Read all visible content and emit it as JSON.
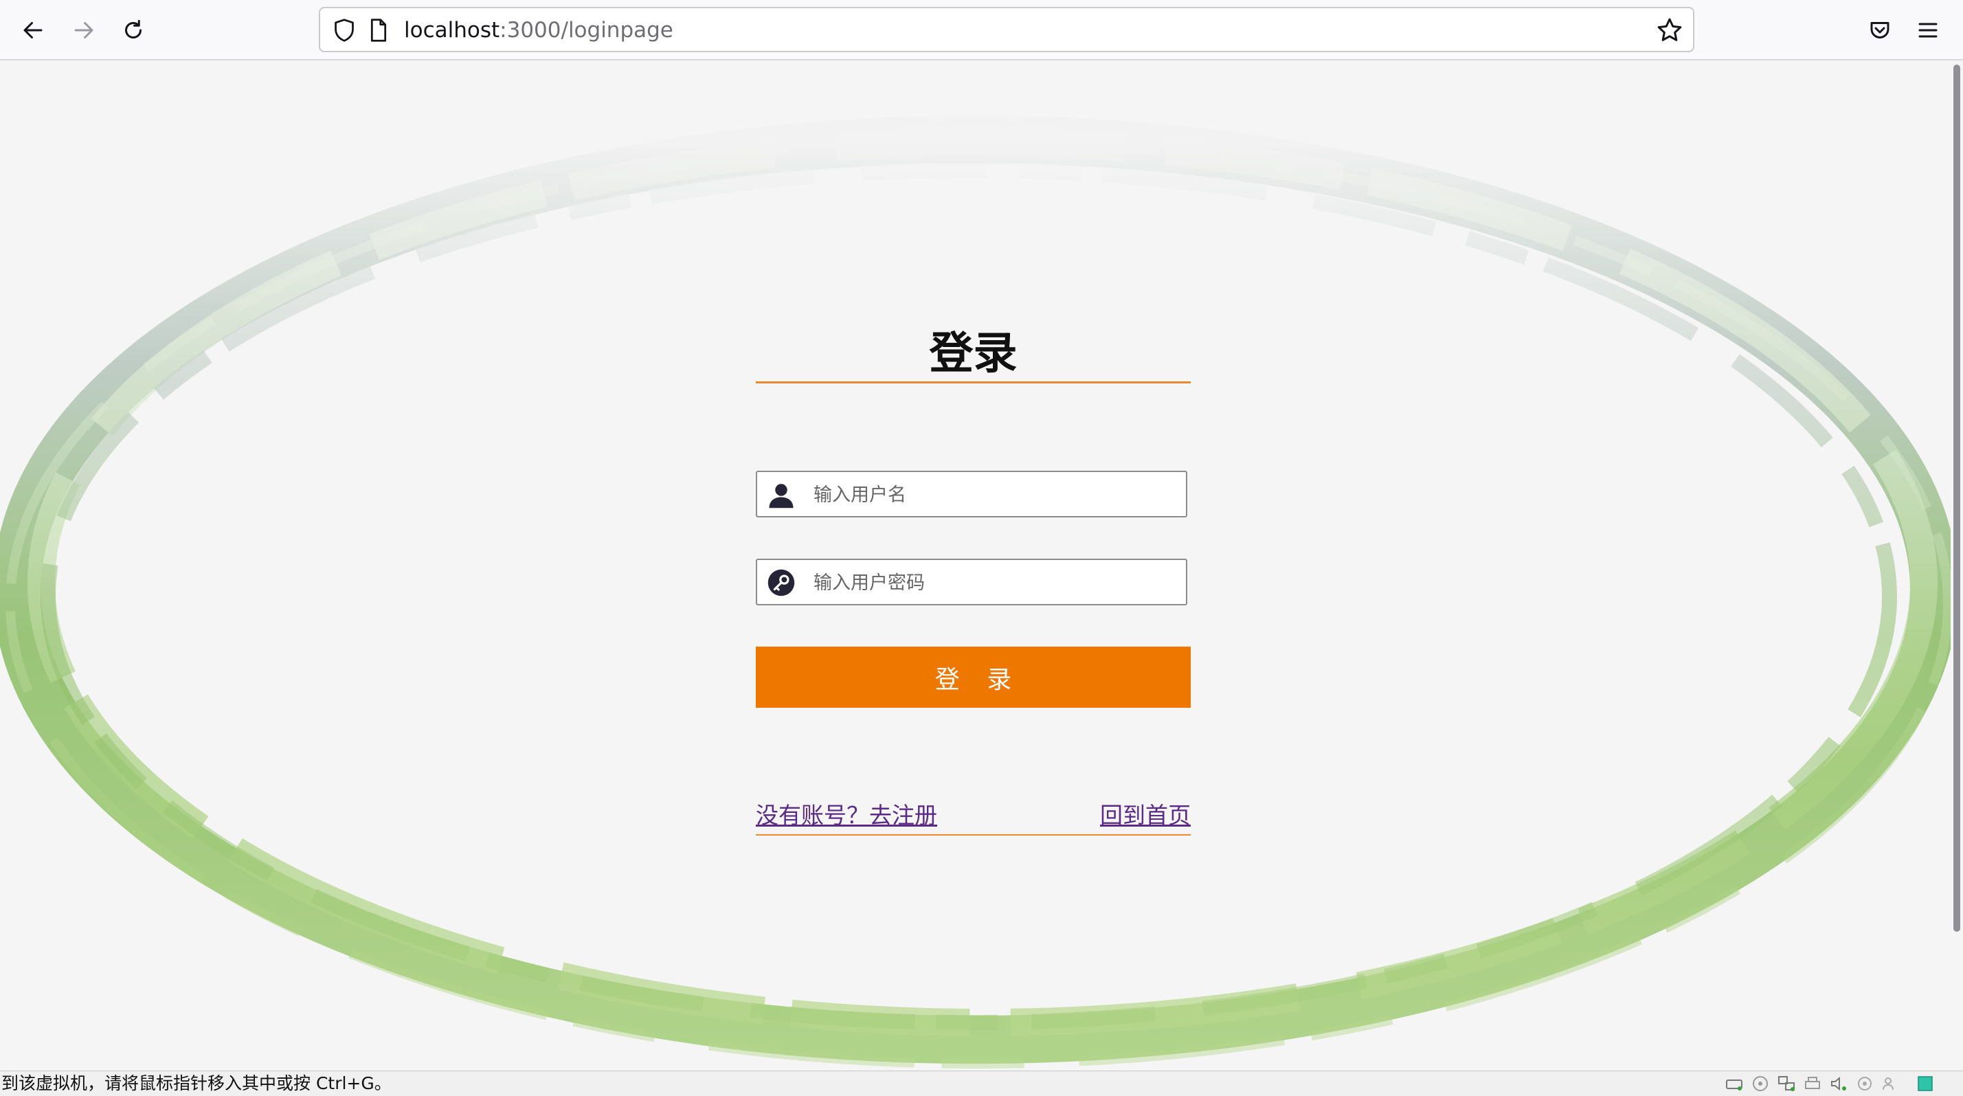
{
  "browser": {
    "url_host": "localhost",
    "url_rest": ":3000/loginpage",
    "icons": [
      "back-arrow-icon",
      "forward-arrow-icon",
      "reload-icon",
      "shield-icon",
      "page-icon",
      "star-icon",
      "pocket-icon",
      "menu-icon"
    ]
  },
  "login": {
    "title": "登录",
    "username_placeholder": "输入用户名",
    "password_placeholder": "输入用户密码",
    "submit_label": "登 录",
    "register_link": "没有账号？去注册",
    "home_link": "回到首页"
  },
  "colors": {
    "accent": "#ee7700",
    "divider": "#e88a2e",
    "link": "#5b2a86",
    "swirl_green": "#8fbf6a"
  },
  "vm_status": {
    "text": "到该虚拟机，请将鼠标指针移入其中或按 Ctrl+G。"
  }
}
